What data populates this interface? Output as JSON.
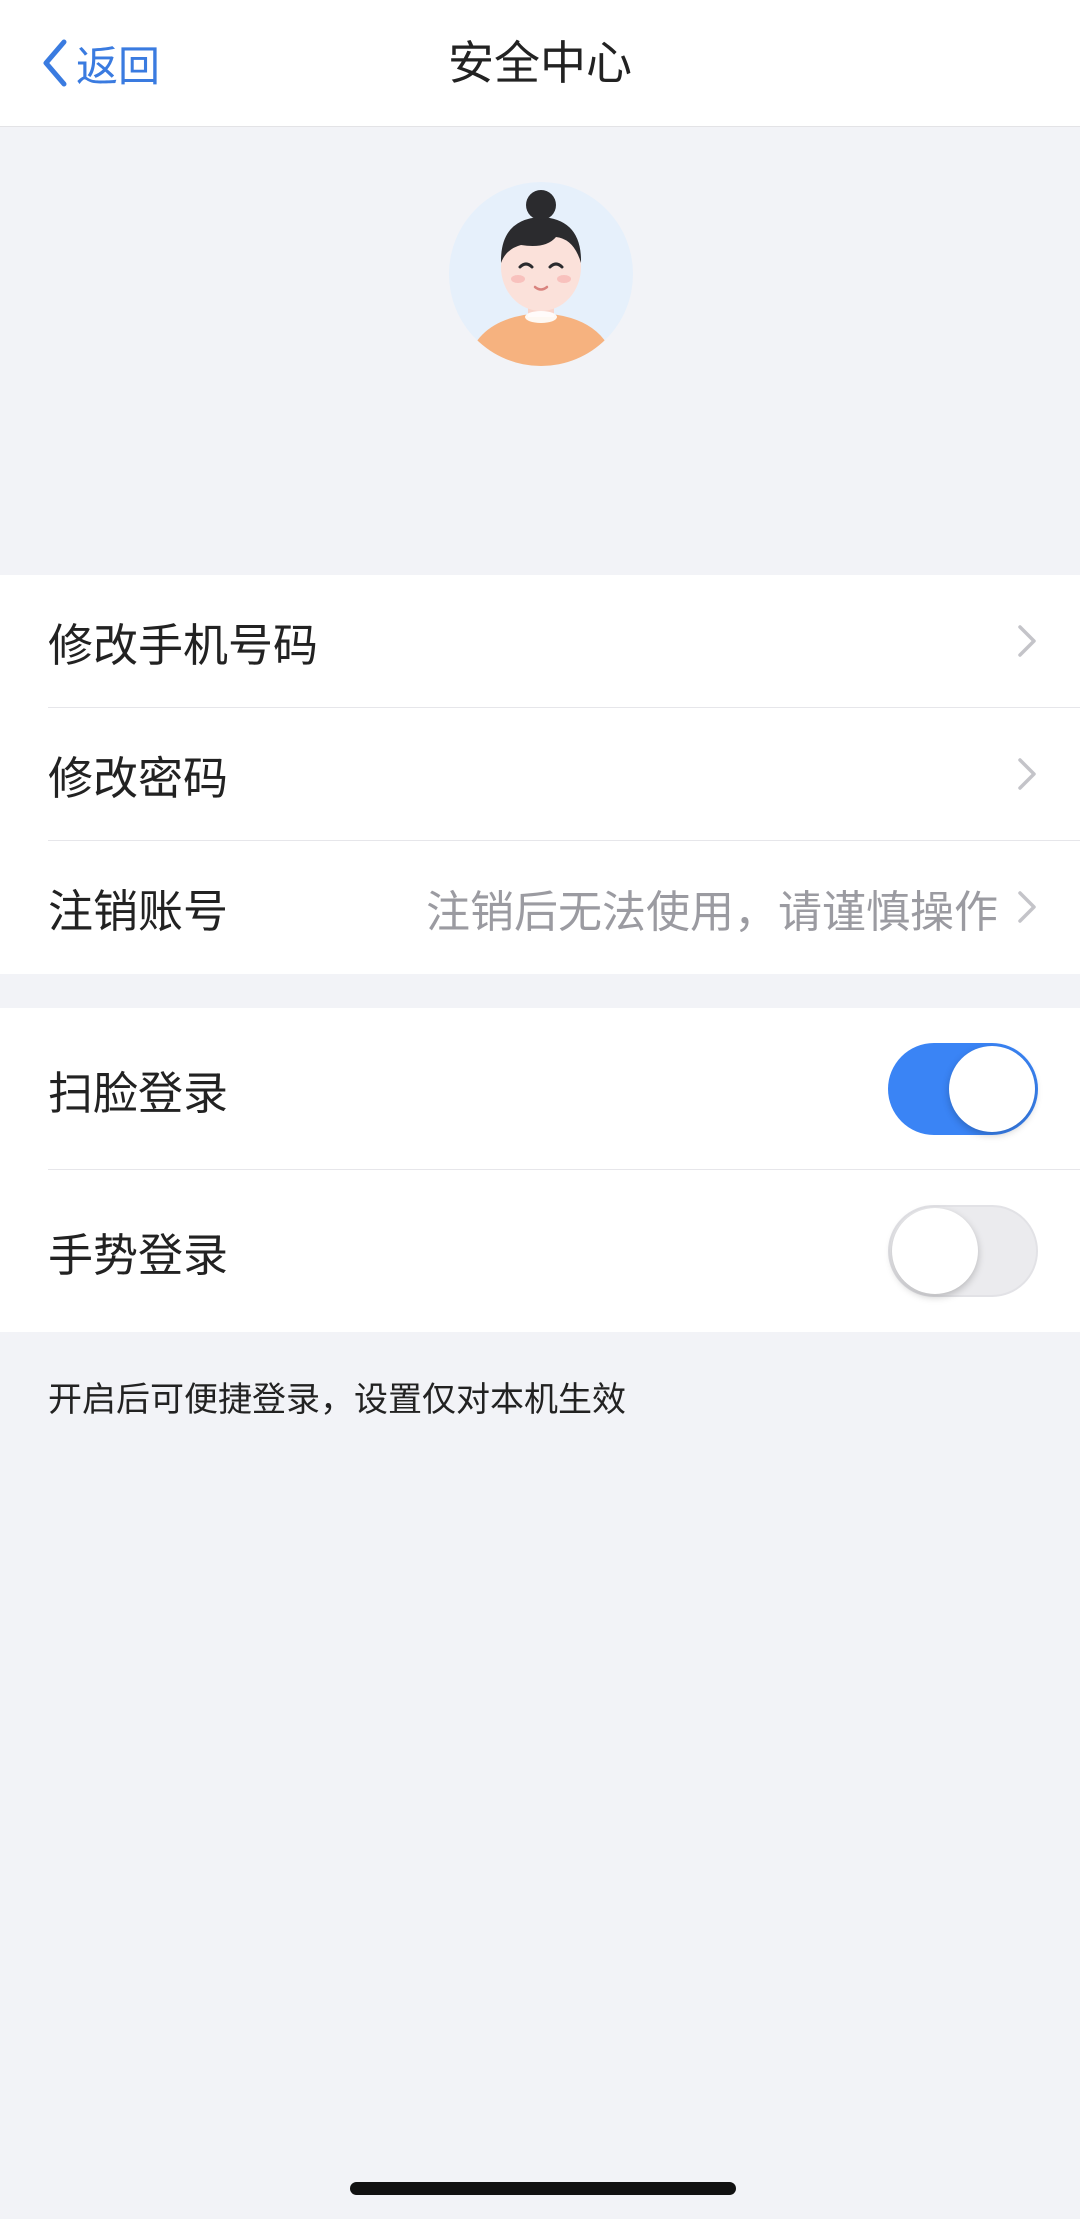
{
  "nav": {
    "back_label": "返回",
    "title": "安全中心",
    "back_icon": "chevron-left-icon"
  },
  "profile": {
    "avatar_icon": "user-avatar-icon",
    "username": "",
    "username_state": "blurred"
  },
  "account_group": {
    "items": [
      {
        "label": "修改手机号码",
        "hint": "",
        "icon": "chevron-right-icon"
      },
      {
        "label": "修改密码",
        "hint": "",
        "icon": "chevron-right-icon"
      },
      {
        "label": "注销账号",
        "hint": "注销后无法使用，请谨慎操作",
        "icon": "chevron-right-icon"
      }
    ]
  },
  "login_group": {
    "items": [
      {
        "label": "扫脸登录",
        "enabled": true
      },
      {
        "label": "手势登录",
        "enabled": false
      }
    ]
  },
  "footnote": "开启后可便捷登录，设置仅对本机生效",
  "colors": {
    "accent": "#3a7be0",
    "switch_on": "#3a84f5",
    "background": "#f2f3f7",
    "hint_text": "#9b9ba1"
  }
}
